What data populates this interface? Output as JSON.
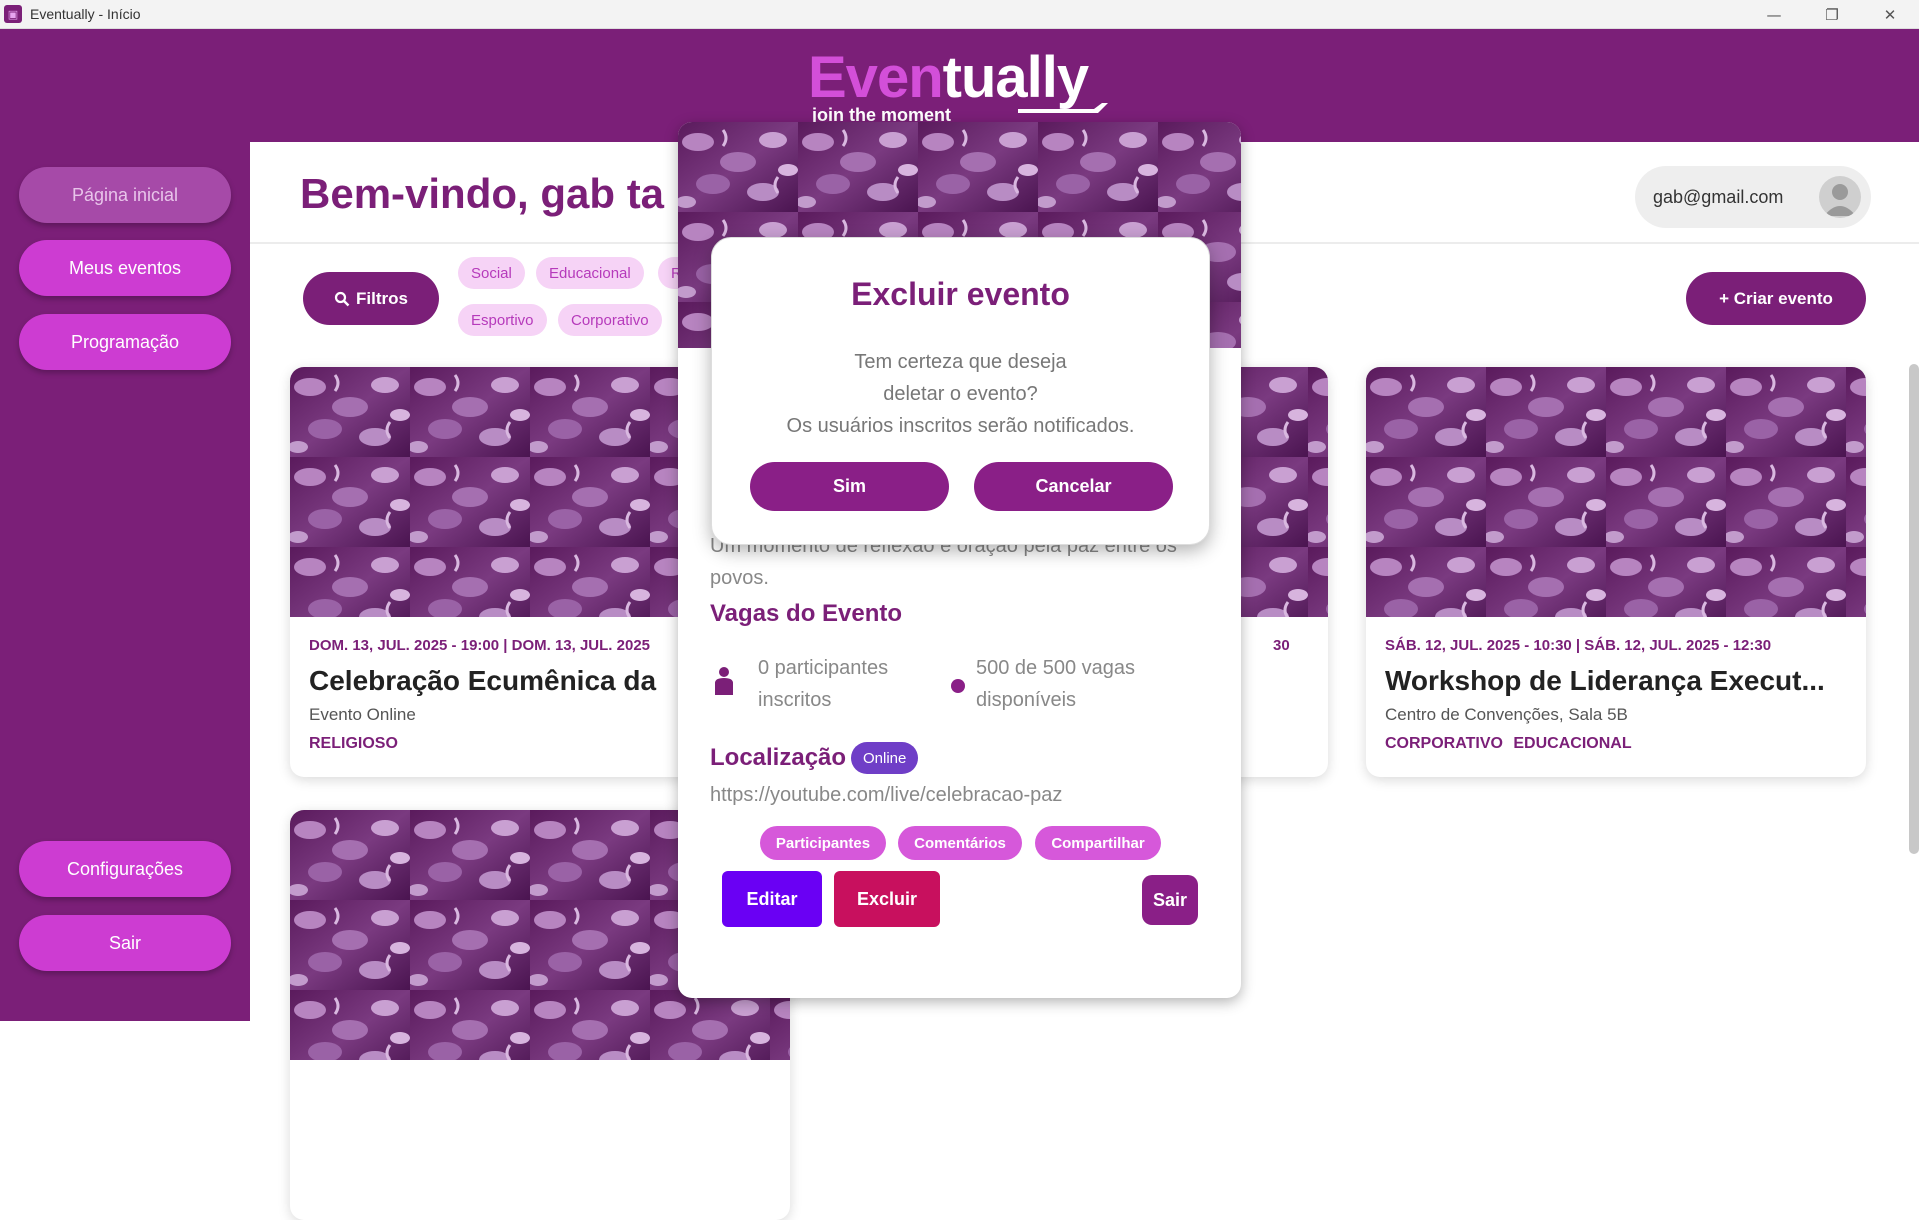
{
  "window": {
    "title": "Eventually - Início",
    "minimize": "—",
    "restore": "❐",
    "close": "✕"
  },
  "logo": {
    "part1": "Even",
    "part2": "tually",
    "tagline": "join the moment"
  },
  "sidebar": {
    "items": [
      {
        "label": "Página inicial",
        "active": true
      },
      {
        "label": "Meus eventos"
      },
      {
        "label": "Programação"
      }
    ],
    "bottom": [
      {
        "label": "Configurações"
      },
      {
        "label": "Sair"
      }
    ]
  },
  "main": {
    "welcome": "Bem-vindo, gab ta",
    "user_email": "gab@gmail.com",
    "filters_label": "Filtros",
    "create_label": "+ Criar evento",
    "chips": [
      "Social",
      "Educacional",
      "R",
      "Esportivo",
      "Corporativo"
    ]
  },
  "cards": [
    {
      "date": "DOM. 13, JUL. 2025 - 19:00 | DOM. 13, JUL. 2025",
      "name": "Celebração Ecumênica da",
      "place": "Evento Online",
      "category": "RELIGIOSO"
    },
    {
      "date": "30"
    },
    {
      "date": "SÁB. 12, JUL. 2025 - 10:30 | SÁB. 12, JUL. 2025 - 12:30",
      "name": "Workshop de Liderança Execut...",
      "place": "Centro de Convenções, Sala 5B",
      "category": "CORPORATIVO EDUCACIONAL"
    }
  ],
  "detail": {
    "description": "Um momento de reflexão e oração pela paz entre os povos.",
    "slots_title": "Vagas do Evento",
    "participants": "0 participantes inscritos",
    "vacancies": "500 de 500 vagas disponíveis",
    "location_title": "Localização",
    "location_badge": "Online",
    "url": "https://youtube.com/live/celebracao-paz",
    "tabs": [
      "Participantes",
      "Comentários",
      "Compartilhar"
    ],
    "edit_label": "Editar",
    "delete_label": "Excluir",
    "exit_label": "Sair",
    "colors": {
      "edit": "#6a00f4",
      "delete": "#c8105e",
      "exit": "#8a1f87"
    }
  },
  "dialog": {
    "title": "Excluir evento",
    "line1": "Tem certeza que deseja",
    "line2": "deletar o evento?",
    "line3": "Os usuários inscritos serão notificados.",
    "yes": "Sim",
    "cancel": "Cancelar"
  },
  "colors": {
    "brand": "#7b1f78",
    "accent": "#cd3cd2",
    "chip_bg": "#f6d3f6"
  }
}
